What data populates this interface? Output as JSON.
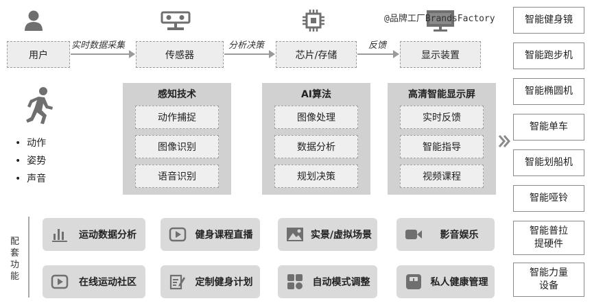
{
  "flow": {
    "nodes": [
      "用户",
      "传感器",
      "芯片/存储",
      "显示装置"
    ],
    "edges": [
      "实时数据采集",
      "分析决策",
      "反馈"
    ]
  },
  "watermark": "@品牌工厂BrandsFactory",
  "actions": [
    "动作",
    "姿势",
    "声音"
  ],
  "panels": [
    {
      "title": "感知技术",
      "items": [
        "动作捕捉",
        "图像识别",
        "语音识别"
      ]
    },
    {
      "title": "AI算法",
      "items": [
        "图像处理",
        "数据分析",
        "规划决策"
      ]
    },
    {
      "title": "高清智能显示屏",
      "items": [
        "实时反馈",
        "智能指导",
        "视频课程"
      ]
    }
  ],
  "devices": [
    "智能健身镜",
    "智能跑步机",
    "智能椭圆机",
    "智能单车",
    "智能划船机",
    "智能哑铃",
    "智能普拉提硬件",
    "智能力量设备"
  ],
  "support": {
    "label": "配套功能",
    "row1": [
      "运动数据分析",
      "健身课程直播",
      "实景/虚拟场景",
      "影音娱乐"
    ],
    "row2": [
      "在线运动社区",
      "定制健身计划",
      "自动模式调整",
      "私人健康管理"
    ]
  },
  "icons": {
    "user": "user-icon",
    "sensor": "camera-sensor-icon",
    "chip": "chip-icon",
    "display": "monitor-icon",
    "runner": "running-person-icon",
    "expand": "double-chevron-right-icon",
    "row1": [
      "bar-chart-icon",
      "play-button-icon",
      "image-icon",
      "video-camera-icon"
    ],
    "row2": [
      "play-button-icon",
      "edit-document-icon",
      "grid-apps-icon",
      "scale-icon"
    ]
  },
  "colors": {
    "icon": "#6f6f6f",
    "panel": "#d1d1d1",
    "box": "#ededed",
    "button": "#dadada",
    "border": "#9a9a9a"
  }
}
